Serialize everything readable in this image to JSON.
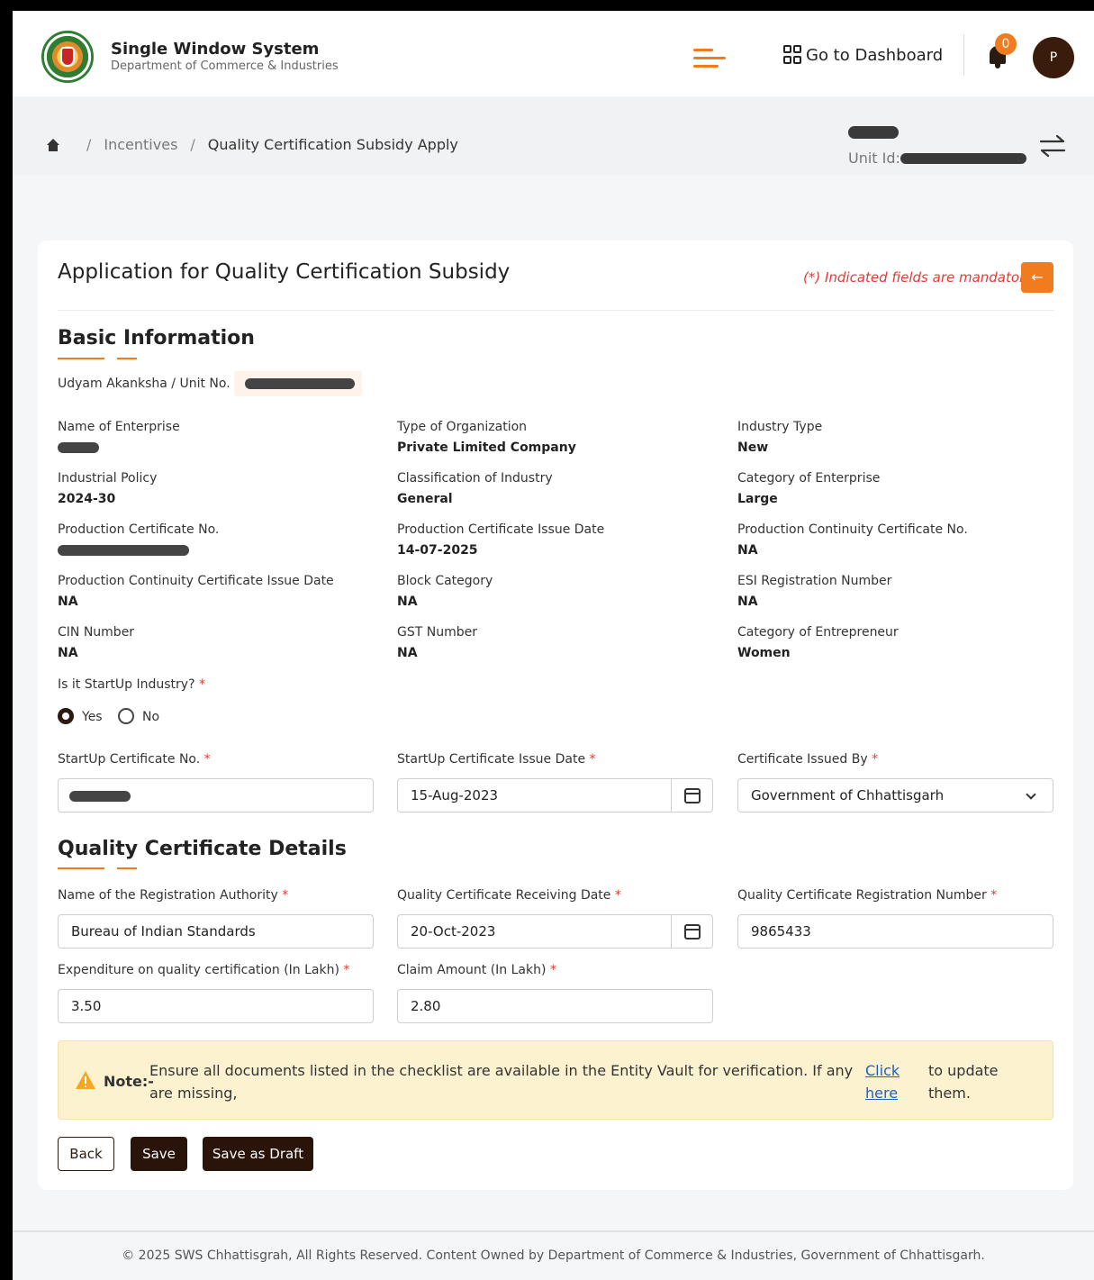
{
  "header": {
    "brand_title": "Single Window System",
    "brand_subtitle": "Department of Commerce & Industries",
    "dashboard_label": "Go to Dashboard",
    "notification_count": "0",
    "avatar_initial": "P"
  },
  "breadcrumb": {
    "items": [
      "Incentives",
      "Quality Certification Subsidy Apply"
    ],
    "separator": "/"
  },
  "unit": {
    "label": "Unit Id:"
  },
  "form": {
    "title": "Application for Quality Certification Subsidy",
    "mandatory_note": "(*) Indicated fields are mandatory",
    "basic_section_title": "Basic Information",
    "udyam_label": "Udyam Akanksha / Unit No.",
    "fields": [
      {
        "label": "Name of Enterprise",
        "value": ""
      },
      {
        "label": "Type of Organization",
        "value": "Private Limited Company"
      },
      {
        "label": "Industry Type",
        "value": "New"
      },
      {
        "label": "Industrial Policy",
        "value": "2024-30"
      },
      {
        "label": "Classification of Industry",
        "value": "General"
      },
      {
        "label": "Category of Enterprise",
        "value": "Large"
      },
      {
        "label": "Production Certificate No.",
        "value": ""
      },
      {
        "label": "Production Certificate Issue Date",
        "value": "14-07-2025"
      },
      {
        "label": "Production Continuity Certificate No.",
        "value": "NA"
      },
      {
        "label": "Production Continuity Certificate Issue Date",
        "value": "NA"
      },
      {
        "label": "Block Category",
        "value": "NA"
      },
      {
        "label": "ESI Registration Number",
        "value": "NA"
      },
      {
        "label": "CIN Number",
        "value": "NA"
      },
      {
        "label": "GST Number",
        "value": "NA"
      },
      {
        "label": "Category of Entrepreneur",
        "value": "Women"
      }
    ],
    "startup_question": "Is it StartUp Industry?",
    "startup_options": [
      "Yes",
      "No"
    ],
    "startup_selected": "Yes",
    "startup_cert_no_label": "StartUp Certificate No.",
    "startup_cert_date_label": "StartUp Certificate Issue Date",
    "startup_cert_date_value": "15-Aug-2023",
    "cert_issued_by_label": "Certificate Issued By",
    "cert_issued_by_value": "Government of Chhattisgarh",
    "quality_section_title": "Quality Certificate Details",
    "reg_authority_label": "Name of the Registration Authority",
    "reg_authority_value": "Bureau of Indian Standards",
    "qc_receiving_date_label": "Quality Certificate Receiving Date",
    "qc_receiving_date_value": "20-Oct-2023",
    "qc_reg_number_label": "Quality Certificate Registration Number",
    "qc_reg_number_value": "9865433",
    "expenditure_label": "Expenditure on quality certification (In Lakh)",
    "expenditure_value": "3.50",
    "claim_label": "Claim Amount (In Lakh)",
    "claim_value": "2.80",
    "required_mark": "*"
  },
  "note": {
    "label": "Note:-",
    "text": "Ensure all documents listed in the checklist are available in the Entity Vault for verification. If any are missing,",
    "link_text": "Click here",
    "tail": "to update them."
  },
  "buttons": {
    "back": "Back",
    "save": "Save",
    "save_draft": "Save as Draft"
  },
  "footer": {
    "text": "© 2025 SWS Chhattisgrah, All Rights Reserved. Content Owned by Department of Commerce & Industries, Government of Chhattisgarh."
  },
  "colors": {
    "accent": "#f07c1f",
    "primary_dark": "#2a1308",
    "mandatory_red": "#e53935",
    "note_bg": "#fdf2cf",
    "link": "#1e5fbf"
  },
  "icons": [
    "emblem-logo",
    "menu-icon",
    "grid-icon",
    "bell-icon",
    "home-icon",
    "swap-icon",
    "arrow-left-icon",
    "calendar-icon",
    "chevron-down-icon",
    "warning-icon"
  ]
}
